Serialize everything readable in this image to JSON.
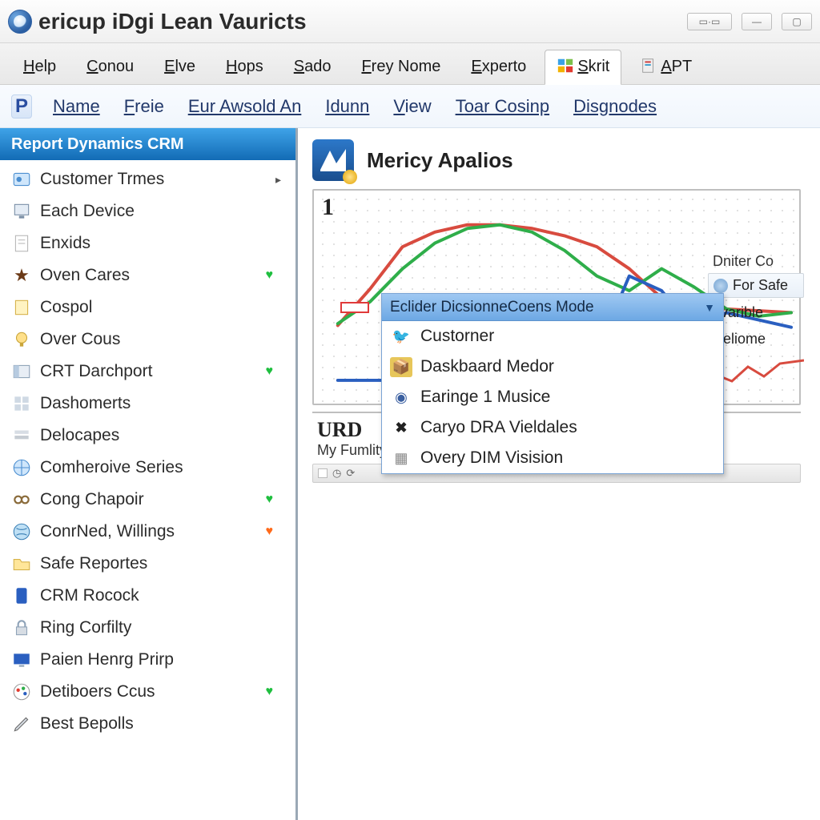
{
  "window": {
    "title": "ericup iDgi Lean Vauricts"
  },
  "ribbon_tabs": [
    {
      "label": "Help"
    },
    {
      "label": "Conou"
    },
    {
      "label": "Elve"
    },
    {
      "label": "Hops"
    },
    {
      "label": "Sado"
    },
    {
      "label": "Frey Nome"
    },
    {
      "label": "Experto"
    },
    {
      "label": "Skrit",
      "active": true,
      "icon": "windows"
    },
    {
      "label": "APT",
      "icon": "doc"
    }
  ],
  "menu": {
    "items": [
      "Name",
      "Freie",
      "Eur Awsold An",
      "Idunn",
      "View",
      "Toar Cosinp",
      "Disgnodes"
    ]
  },
  "sidebar": {
    "title": "Report Dynamics CRM",
    "items": [
      {
        "label": "Customer Trmes",
        "icon": "cust",
        "caret": true
      },
      {
        "label": "Each Device",
        "icon": "device"
      },
      {
        "label": "Enxids",
        "icon": "page"
      },
      {
        "label": "Oven Cares",
        "icon": "star",
        "heart": "green"
      },
      {
        "label": "Cospol",
        "icon": "note"
      },
      {
        "label": "Over Cous",
        "icon": "bulb"
      },
      {
        "label": "CRT Darchport",
        "icon": "panel",
        "heart": "green"
      },
      {
        "label": "Dashomerts",
        "icon": "grid"
      },
      {
        "label": "Delocapes",
        "icon": "stack"
      },
      {
        "label": "Comheroive Series",
        "icon": "globe"
      },
      {
        "label": "Cong Chapoir",
        "icon": "chain",
        "heart": "green"
      },
      {
        "label": "ConrNed, Willings",
        "icon": "world",
        "heart": "orange"
      },
      {
        "label": "Safe Reportes",
        "icon": "folder"
      },
      {
        "label": "CRM Rocock",
        "icon": "devblue"
      },
      {
        "label": "Ring Corfilty",
        "icon": "lock"
      },
      {
        "label": "Paien Henrg Prirp",
        "icon": "screen"
      },
      {
        "label": "Detiboers Ccus",
        "icon": "paint",
        "heart": "green"
      },
      {
        "label": "Best Bepolls",
        "icon": "pen"
      }
    ]
  },
  "main": {
    "title": "Mericy Apalios",
    "corner_label": "1",
    "second_title": "URD",
    "second_sub": "My Fumlity Serviol"
  },
  "legend": {
    "header": "Dniter Co",
    "rows": [
      {
        "label": "For Safe",
        "style": "boxed"
      },
      {
        "label": "avarible",
        "style": "plain"
      },
      {
        "label": "Deliome",
        "style": "plain"
      }
    ]
  },
  "dropdown": {
    "header": "Eclider DicsionneCoens Mode",
    "items": [
      {
        "label": "Custorner",
        "icon": "twitter"
      },
      {
        "label": "Daskbaard Medor",
        "icon": "box"
      },
      {
        "label": "Earinge 1 Musice",
        "icon": "disc"
      },
      {
        "label": "Caryo DRA Vieldales",
        "icon": "x"
      },
      {
        "label": "Overy DIM Visision",
        "icon": "cal"
      }
    ]
  },
  "colors": {
    "series_red": "#d84b3f",
    "series_green": "#2fae4a",
    "series_blue": "#2a5fc0"
  },
  "chart_data": {
    "type": "line",
    "title": "Mericy Apalios",
    "x": [
      0,
      1,
      2,
      3,
      4,
      5,
      6,
      7,
      8,
      9,
      10,
      11,
      12,
      13,
      14
    ],
    "xlim": [
      0,
      14
    ],
    "ylim": [
      0,
      1
    ],
    "series": [
      {
        "name": "red",
        "color": "#d84b3f",
        "values": [
          0.35,
          0.55,
          0.78,
          0.86,
          0.9,
          0.9,
          0.88,
          0.84,
          0.78,
          0.66,
          0.5,
          0.45,
          0.44,
          0.43,
          0.42
        ]
      },
      {
        "name": "green",
        "color": "#2fae4a",
        "values": [
          0.36,
          0.48,
          0.66,
          0.8,
          0.88,
          0.9,
          0.86,
          0.76,
          0.62,
          0.54,
          0.66,
          0.56,
          0.44,
          0.4,
          0.42
        ]
      },
      {
        "name": "blue",
        "color": "#2a5fc0",
        "values": [
          0.05,
          0.05,
          0.05,
          0.05,
          0.05,
          0.05,
          0.05,
          0.08,
          0.2,
          0.62,
          0.54,
          0.32,
          0.42,
          0.38,
          0.34
        ]
      }
    ]
  }
}
